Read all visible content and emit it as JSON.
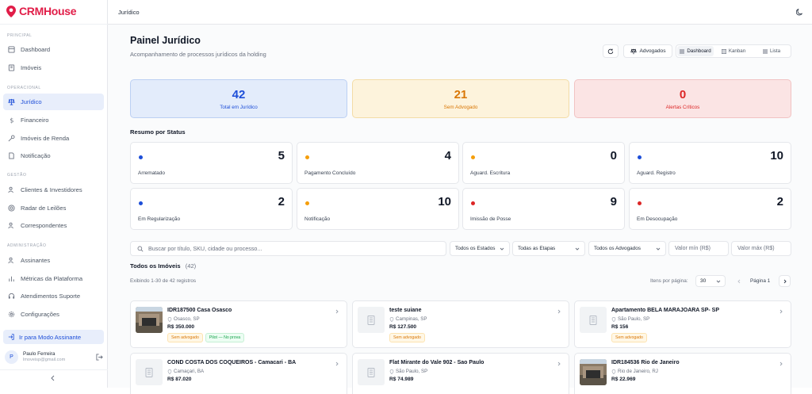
{
  "brand": {
    "name": "CRMHouse",
    "color": "#e11d48"
  },
  "sidebar": {
    "sections": [
      {
        "label": "PRINCIPAL"
      },
      {
        "label": "OPERACIONAL"
      },
      {
        "label": "GESTÃO"
      },
      {
        "label": "ADMINISTRAÇÃO"
      }
    ],
    "items": [
      {
        "label": "Dashboard",
        "icon": "dashboard-icon"
      },
      {
        "label": "Imóveis",
        "icon": "building-icon"
      },
      {
        "label": "Jurídico",
        "icon": "scale-icon",
        "active": true
      },
      {
        "label": "Financeiro",
        "icon": "dollar-icon"
      },
      {
        "label": "Imóveis de Renda",
        "icon": "key-icon"
      },
      {
        "label": "Notificação",
        "icon": "document-icon"
      },
      {
        "label": "Clientes & Investidores",
        "icon": "users-icon"
      },
      {
        "label": "Radar de Leilões",
        "icon": "radar-icon"
      },
      {
        "label": "Correspondentes",
        "icon": "users-icon"
      },
      {
        "label": "Assinantes",
        "icon": "users-icon"
      },
      {
        "label": "Métricas da Plataforma",
        "icon": "chart-icon"
      },
      {
        "label": "Atendimentos Suporte",
        "icon": "headset-icon"
      },
      {
        "label": "Configurações",
        "icon": "gear-icon"
      }
    ],
    "modo_assinante": "Ir para Modo Assinante",
    "user": {
      "initial": "P",
      "name": "Paulo Ferreira",
      "email": "lmoveisp@gmail.com"
    }
  },
  "topbar": {
    "breadcrumb": "Jurídico"
  },
  "header": {
    "title": "Painel Jurídico",
    "subtitle": "Acompanhamento de processos jurídicos da holding",
    "advogados_label": "Advogados",
    "views": [
      "Dashboard",
      "Kanban",
      "Lista"
    ]
  },
  "kpis": [
    {
      "value": "42",
      "label": "Total em Jurídico",
      "color": "#1d4ed8",
      "bg": "#e3ecfb",
      "border": "#bcd0f3"
    },
    {
      "value": "21",
      "label": "Sem Advogado",
      "color": "#d97706",
      "bg": "#fdf3dc",
      "border": "#f3dca7"
    },
    {
      "value": "0",
      "label": "Alertas Críticos",
      "color": "#dc2626",
      "bg": "#fbe4e4",
      "border": "#f1c3c3"
    }
  ],
  "status": {
    "title": "Resumo por Status",
    "cards": [
      {
        "label": "Arrematado",
        "value": "5",
        "dot": "#1d4ed8"
      },
      {
        "label": "Pagamento Concluído",
        "value": "4",
        "dot": "#f59e0b"
      },
      {
        "label": "Aguard. Escritura",
        "value": "0",
        "dot": "#f59e0b"
      },
      {
        "label": "Aguard. Registro",
        "value": "10",
        "dot": "#1d4ed8"
      },
      {
        "label": "Em Regularização",
        "value": "2",
        "dot": "#1d4ed8"
      },
      {
        "label": "Notificação",
        "value": "10",
        "dot": "#f59e0b"
      },
      {
        "label": "Imissão de Posse",
        "value": "9",
        "dot": "#dc2626"
      },
      {
        "label": "Em Desocupação",
        "value": "2",
        "dot": "#dc2626"
      }
    ]
  },
  "filters": {
    "search_placeholder": "Buscar por título, SKU, cidade ou processo...",
    "estados": "Todos os Estados",
    "etapas": "Todas as Etapas",
    "advogados": "Todos os Advogados",
    "valor_min": "Valor mín (R$)",
    "valor_max": "Valor máx (R$)"
  },
  "list": {
    "title": "Todos os Imóveis",
    "count": "(42)",
    "showing": "Exibindo 1-30 de 42 registros",
    "per_page_label": "Itens por página:",
    "per_page": "30",
    "page_label": "Página 1"
  },
  "properties": [
    {
      "title": "IDR187500 Casa Osasco",
      "location": "Osasco, SP",
      "price": "R$ 350.000",
      "badges": [
        "Sem advogado",
        "Pilot — No prova"
      ],
      "photo": true
    },
    {
      "title": "teste suiane",
      "location": "Campinas, SP",
      "price": "R$ 127.500",
      "badges": [
        "Sem advogado"
      ],
      "photo": false
    },
    {
      "title": "Apartamento BELA MARAJOARA SP- SP",
      "location": "São Paulo, SP",
      "price": "R$ 156",
      "badges": [
        "Sem advogado"
      ],
      "photo": false
    },
    {
      "title": "COND COSTA DOS COQUEIROS - Camacari - BA",
      "location": "Camaçari, BA",
      "price": "R$ 87.020",
      "badges": [],
      "photo": false
    },
    {
      "title": "Flat Mirante do Vale 902 - Sao Paulo",
      "location": "São Paulo, SP",
      "price": "R$ 74.989",
      "badges": [],
      "photo": false
    },
    {
      "title": "IDR184536 Rio de Janeiro",
      "location": "Rio de Janeiro, RJ",
      "price": "R$ 22.969",
      "badges": [],
      "photo": true
    }
  ]
}
